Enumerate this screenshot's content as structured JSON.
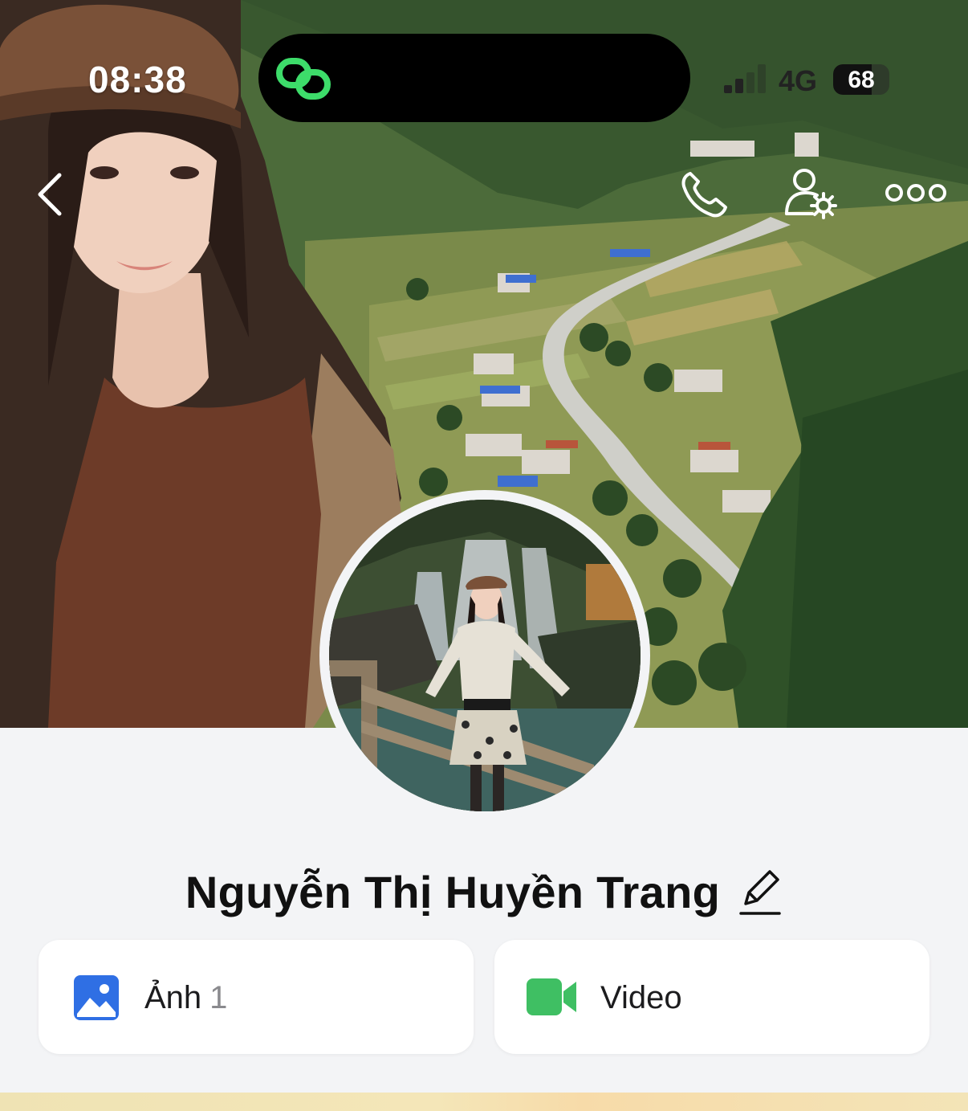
{
  "status_bar": {
    "time": "08:38",
    "network": "4G",
    "battery": "68",
    "battery_level": 0.68
  },
  "nav": {
    "back_icon": "chevron-left-icon",
    "call_icon": "phone-icon",
    "profile_settings_icon": "user-settings-icon",
    "more_icon": "more-horizontal-icon"
  },
  "profile": {
    "name": "Nguyễn Thị Huyền Trang",
    "edit_icon": "pencil-icon"
  },
  "media": {
    "photos": {
      "label": "Ảnh",
      "count": "1",
      "icon": "image-icon",
      "icon_color": "#2f6fe4"
    },
    "videos": {
      "label": "Video",
      "icon": "video-camera-icon",
      "icon_color": "#3fbf63"
    }
  },
  "colors": {
    "background": "#f3f4f6",
    "card": "#ffffff",
    "text": "#111111",
    "muted": "#8a8a8e",
    "island_icon": "#3ddc6a"
  }
}
